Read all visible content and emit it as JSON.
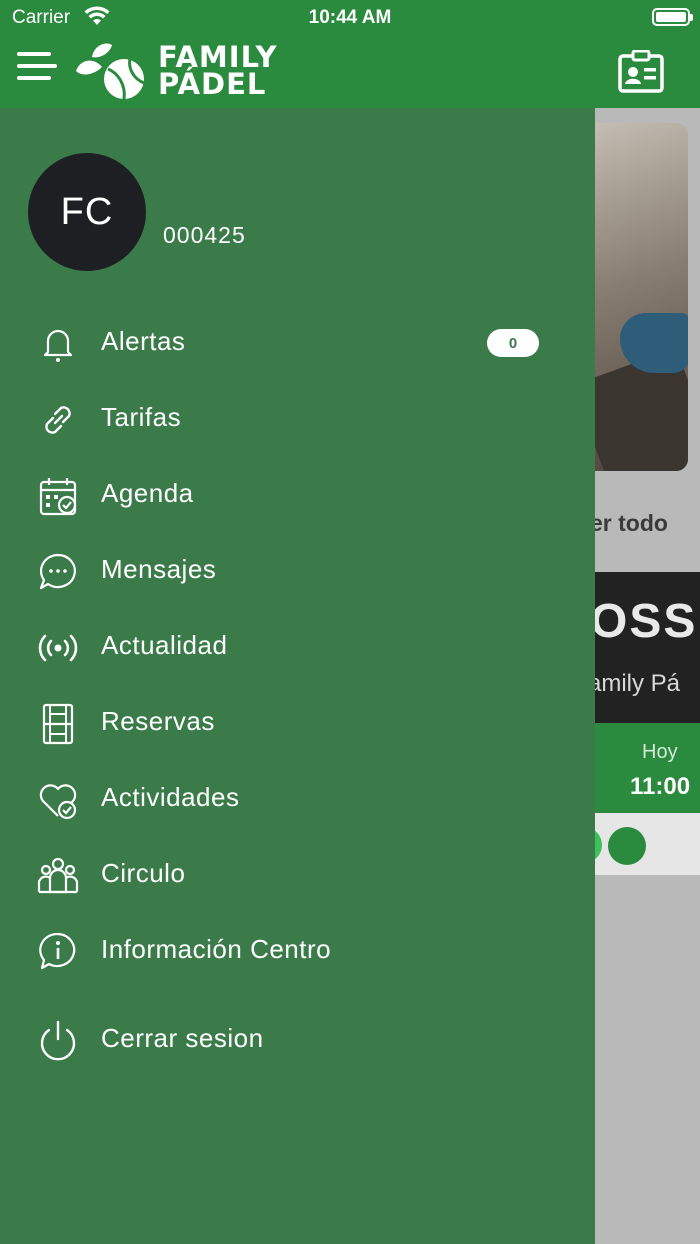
{
  "status_bar": {
    "carrier": "Carrier",
    "time": "10:44 AM"
  },
  "header": {
    "logo_line1": "FAMILY",
    "logo_line2": "PÁDEL"
  },
  "profile": {
    "initials": "FC",
    "member_id": "000425"
  },
  "menu": [
    {
      "label": "Alertas",
      "icon": "bell-icon",
      "badge": "0"
    },
    {
      "label": "Tarifas",
      "icon": "link-icon"
    },
    {
      "label": "Agenda",
      "icon": "calendar-check-icon"
    },
    {
      "label": "Mensajes",
      "icon": "chat-bubble-icon"
    },
    {
      "label": "Actualidad",
      "icon": "broadcast-icon"
    },
    {
      "label": "Reservas",
      "icon": "court-icon"
    },
    {
      "label": "Actividades",
      "icon": "heart-check-icon"
    },
    {
      "label": "Circulo",
      "icon": "group-icon"
    },
    {
      "label": "Información Centro",
      "icon": "info-chat-icon"
    },
    {
      "label": "Cerrar sesion",
      "icon": "power-icon"
    }
  ],
  "background": {
    "see_all": "er todo",
    "event_title": "OSS",
    "event_subtitle": "amily Pá",
    "event_day": "Hoy",
    "event_time": "11:00"
  },
  "colors": {
    "header_green": "#2a8a3e",
    "drawer_green": "#3b7b4a",
    "avatar_bg": "#1d1f22"
  }
}
